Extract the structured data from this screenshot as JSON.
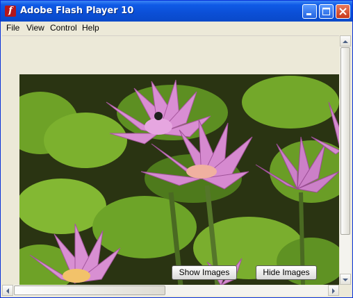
{
  "window": {
    "title": "Adobe Flash Player 10",
    "app_icon_glyph": "f",
    "title_color": "#ffffff",
    "titlebar_color": "#0b4fd6"
  },
  "menu": {
    "items": [
      {
        "label": "File"
      },
      {
        "label": "View"
      },
      {
        "label": "Control"
      },
      {
        "label": "Help"
      }
    ]
  },
  "content": {
    "image_subject": "pink water lilies with green lily pads",
    "show_button_label": "Show Images",
    "hide_button_label": "Hide Images"
  },
  "scrollbars": {
    "vertical_icons": [
      "scroll-up-arrow-icon",
      "scroll-down-arrow-icon"
    ],
    "horizontal_icons": [
      "scroll-left-arrow-icon",
      "scroll-right-arrow-icon"
    ]
  }
}
